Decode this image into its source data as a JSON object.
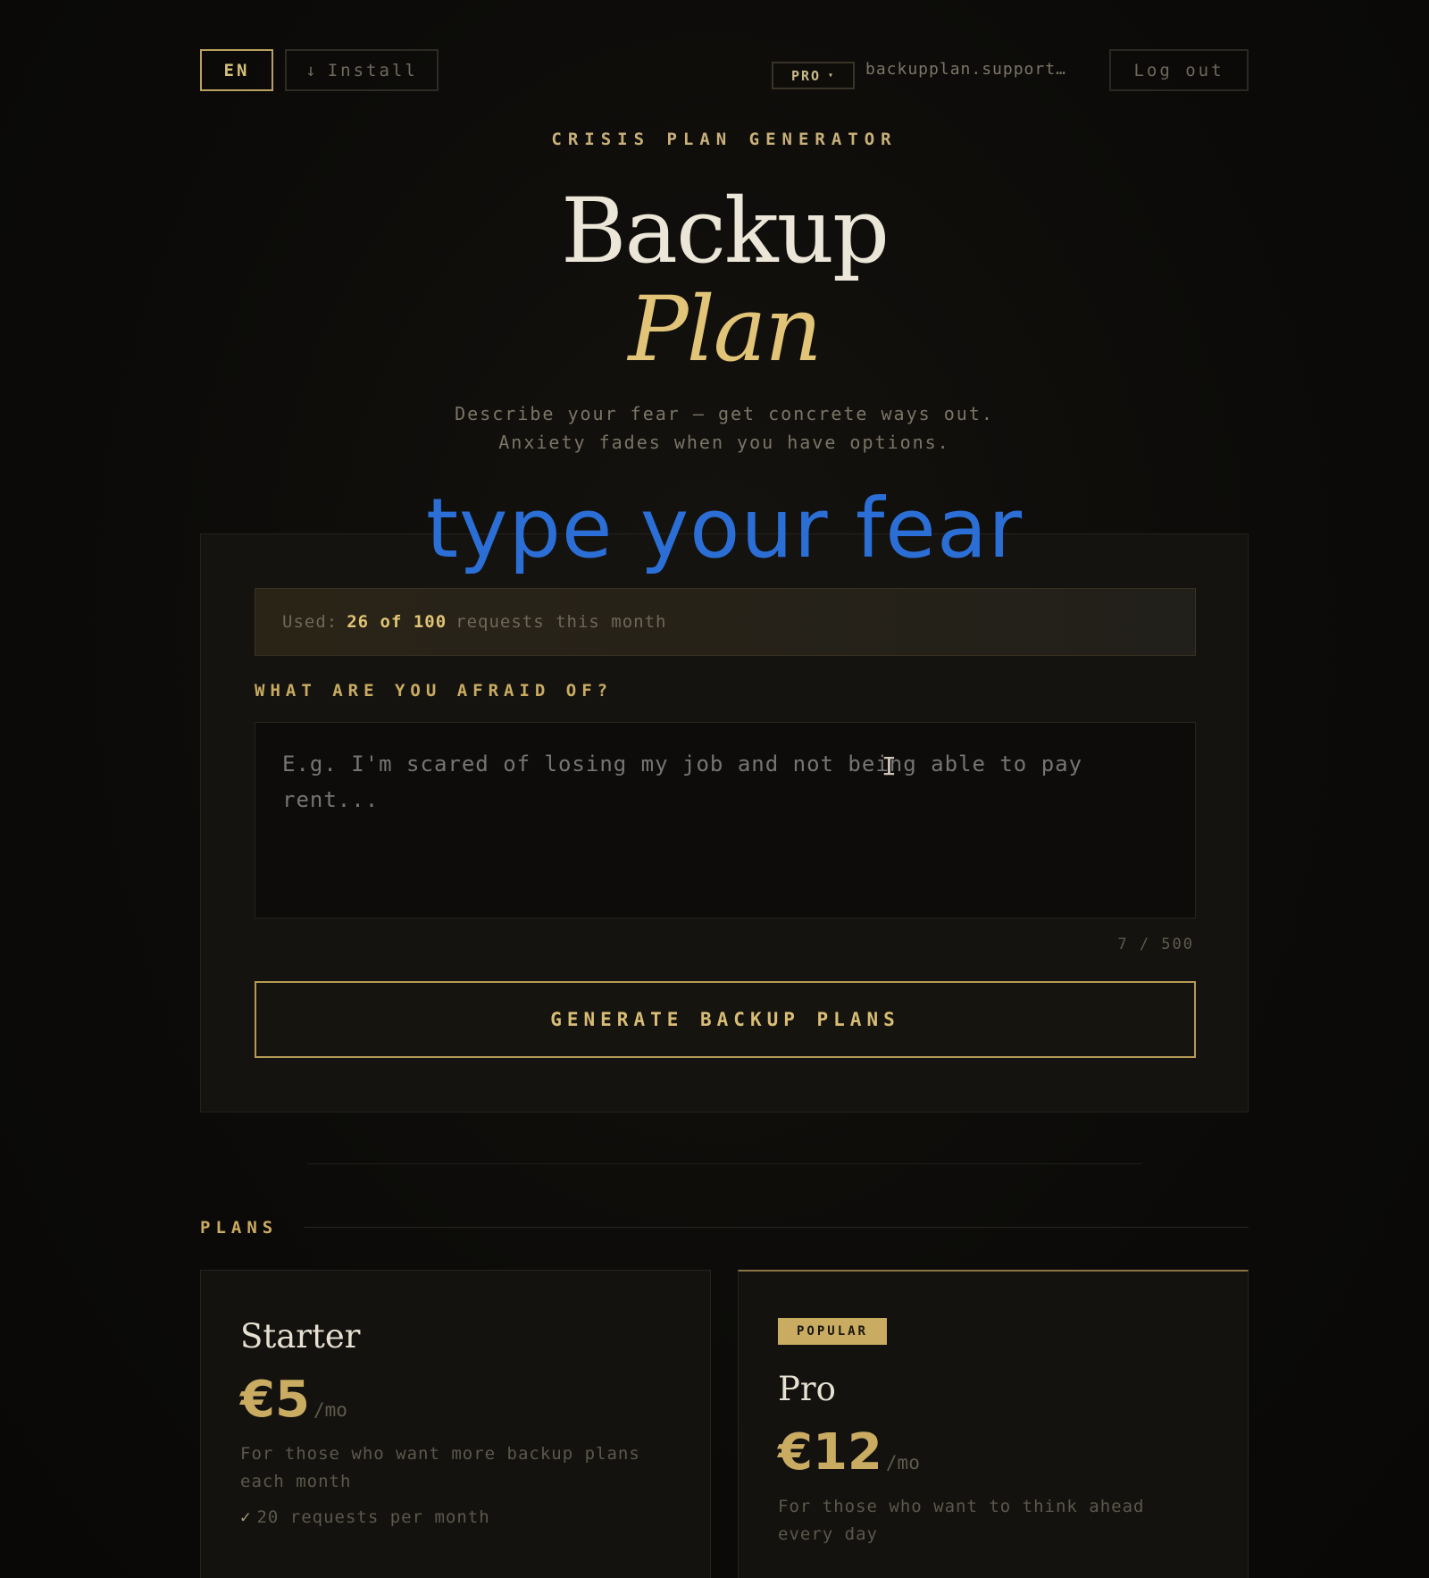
{
  "header": {
    "lang": "EN",
    "install": {
      "icon": "download-arrow-icon",
      "label": "Install",
      "glyph": "↓"
    },
    "plan_badge": {
      "label": "PRO",
      "glyph": "▾"
    },
    "email": "backupplan.support…",
    "logout": "Log out"
  },
  "hero": {
    "eyebrow": "CRISIS PLAN GENERATOR",
    "title_line1": "Backup",
    "title_line2": "Plan",
    "subtitle_line1": "Describe your fear — get concrete ways out.",
    "subtitle_line2": "Anxiety fades when you have options."
  },
  "overlay_caption": "type your fear",
  "form": {
    "usage_prefix": "Used:",
    "usage_value": "26 of 100",
    "usage_suffix": "requests this month",
    "label": "WHAT ARE YOU AFRAID OF?",
    "placeholder": "E.g. I'm scared of losing my job and not being able to pay rent...",
    "counter": "7 / 500",
    "submit": "GENERATE BACKUP PLANS"
  },
  "plans": {
    "heading": "PLANS",
    "items": [
      {
        "name": "Starter",
        "price": "€5",
        "period": "/mo",
        "description": "For those who want more backup plans each month",
        "features": [
          "20 requests per month"
        ]
      },
      {
        "badge": "POPULAR",
        "name": "Pro",
        "price": "€12",
        "period": "/mo",
        "description": "For those who want to think ahead every day"
      }
    ]
  },
  "colors": {
    "accent": "#c9ab62",
    "background": "#0c0b09",
    "overlay_text": "#2b6fd6"
  }
}
